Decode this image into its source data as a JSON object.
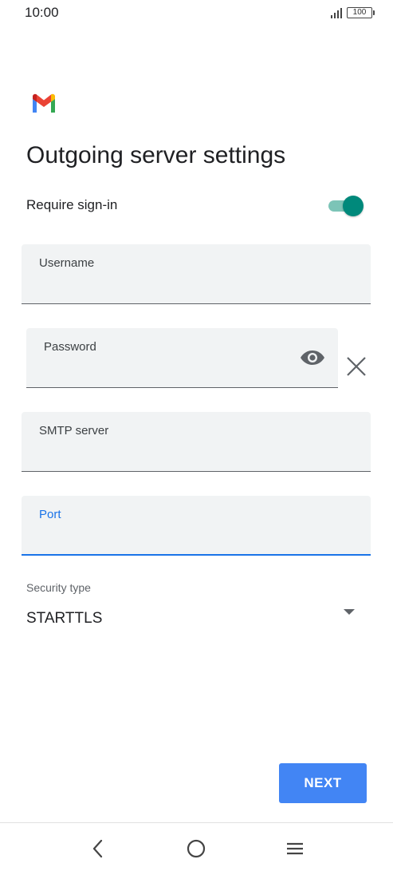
{
  "status_bar": {
    "time": "10:00",
    "battery": "100",
    "icons": [
      "signal-icon",
      "battery-icon"
    ]
  },
  "app": {
    "logo": "gmail-logo"
  },
  "page": {
    "title": "Outgoing server settings"
  },
  "require_signin": {
    "label": "Require sign-in",
    "enabled": true
  },
  "fields": {
    "username": {
      "label": "Username",
      "value": ""
    },
    "password": {
      "label": "Password",
      "value": "",
      "icons": [
        "eye-icon",
        "close-icon"
      ]
    },
    "smtp_server": {
      "label": "SMTP server",
      "value": ""
    },
    "port": {
      "label": "Port",
      "value": "",
      "focused": true
    }
  },
  "security": {
    "label": "Security type",
    "value": "STARTTLS",
    "icon": "dropdown-arrow-icon"
  },
  "actions": {
    "next_label": "NEXT"
  },
  "nav_bar": {
    "icons": [
      "back-icon",
      "home-icon",
      "menu-icon"
    ]
  },
  "colors": {
    "accent": "#1a73e8",
    "button": "#4285f4",
    "toggle": "#00897b",
    "field_background": "#f1f3f4"
  }
}
